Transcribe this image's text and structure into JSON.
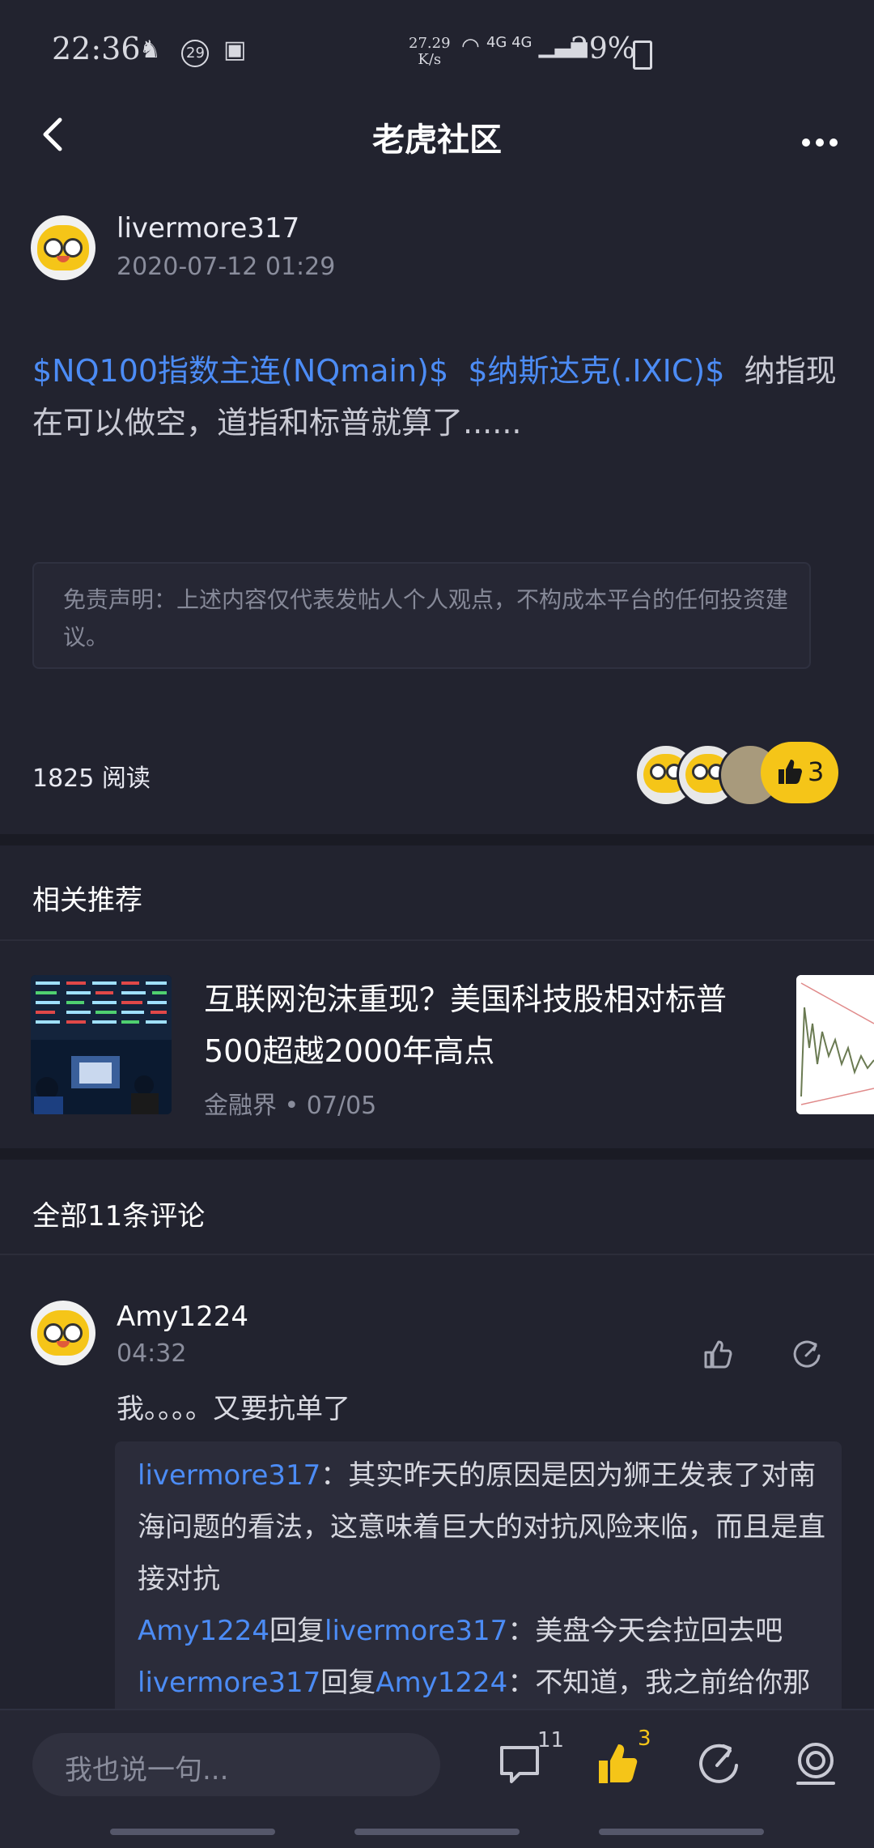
{
  "status_bar": {
    "time": "22:36",
    "notif_count": "29",
    "net_speed_value": "27.29",
    "net_speed_unit": "K/s",
    "network": "4G 4G",
    "battery": "29%"
  },
  "nav": {
    "title": "老虎社区"
  },
  "post": {
    "author": "livermore317",
    "datetime": "2020-07-12 01:29",
    "tag1": "$NQ100指数主连(NQmain)$",
    "tag2": "$纳斯达克(.IXIC)$",
    "text": "纳指现在可以做空，道指和标普就算了......",
    "disclaimer": "免责声明：上述内容仅代表发帖人个人观点，不构成本平台的任何投资建议。",
    "reads": "1825 阅读",
    "like_count": "3"
  },
  "recommend": {
    "section_title": "相关推荐",
    "item": {
      "title": "互联网泡沫重现？美国科技股相对标普500超越2000年高点",
      "source": "金融界",
      "sep": "•",
      "date": "07/05"
    }
  },
  "comments": {
    "section_title": "全部11条评论",
    "first": {
      "user": "Amy1224",
      "time": "04:32",
      "text": "我。。。。又要抗单了",
      "replies": [
        {
          "user": "livermore317",
          "reply_word": "",
          "target": "",
          "text": "：其实昨天的原因是因为狮王发表了对南海问题的看法，这意味着巨大的对抗风险来临，而且是直接对抗"
        },
        {
          "user": "Amy1224",
          "reply_word": "回复",
          "target": "livermore317",
          "text": "：美盘今天会拉回去吧"
        },
        {
          "user": "livermore317",
          "reply_word": "回复",
          "target": "Amy1224",
          "text": "：不知道，我之前给你那"
        }
      ]
    }
  },
  "bottom_bar": {
    "input_placeholder": "我也说一句...",
    "comment_count": "11",
    "like_count": "3"
  },
  "colors": {
    "background": "#22232f",
    "link_blue": "#4c8cf5",
    "accent_yellow": "#f5c518"
  }
}
